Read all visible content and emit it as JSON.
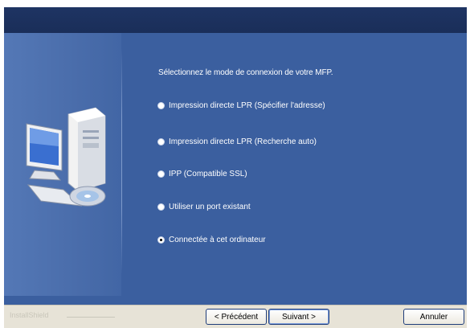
{
  "prompt": "Sélectionnez le mode de connexion de votre MFP.",
  "options": [
    {
      "label": "Impression directe LPR (Spécifier l'adresse)",
      "checked": false
    },
    {
      "label": "Impression directe LPR (Recherche auto)",
      "checked": false
    },
    {
      "label": "IPP (Compatible SSL)",
      "checked": false
    },
    {
      "label": "Utiliser un port existant",
      "checked": false
    },
    {
      "label": "Connectée à cet ordinateur",
      "checked": true
    }
  ],
  "footer": {
    "brand": "InstallShield",
    "back_label": "< Précédent",
    "next_label": "Suivant >",
    "cancel_label": "Annuler"
  },
  "colors": {
    "panel": "#3b5f9f",
    "header": "#1e3463",
    "footer": "#e7e3d7"
  }
}
